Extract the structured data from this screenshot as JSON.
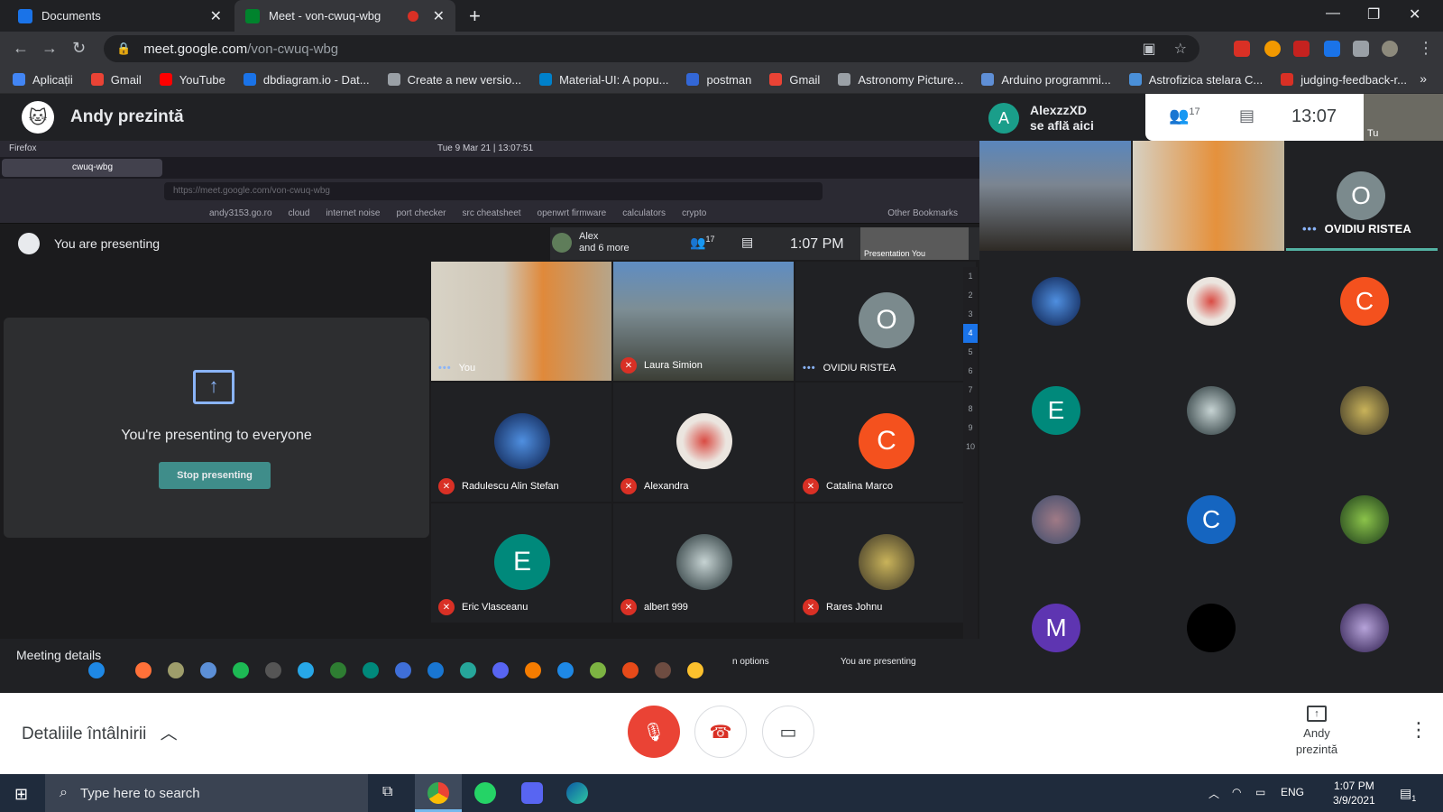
{
  "browser": {
    "tabs": [
      {
        "title": "Documents",
        "favicon_color": "#1a73e8"
      },
      {
        "title": "Meet - von-cwuq-wbg",
        "favicon_color": "#00832d",
        "recording": true
      }
    ],
    "url_host": "meet.google.com",
    "url_path": "/von-cwuq-wbg",
    "bookmarks": [
      {
        "label": "Aplicații",
        "icon_color": "#4285f4"
      },
      {
        "label": "Gmail",
        "icon_color": "#ea4335"
      },
      {
        "label": "YouTube",
        "icon_color": "#ff0000"
      },
      {
        "label": "dbdiagram.io - Dat...",
        "icon_color": "#1a73e8"
      },
      {
        "label": "Create a new versio...",
        "icon_color": "#9aa0a6"
      },
      {
        "label": "Material-UI: A popu...",
        "icon_color": "#0081cb"
      },
      {
        "label": "postman",
        "icon_color": "#3367d6"
      },
      {
        "label": "Gmail",
        "icon_color": "#ea4335"
      },
      {
        "label": "Astronomy Picture...",
        "icon_color": "#9aa0a6"
      },
      {
        "label": "Arduino programmi...",
        "icon_color": "#5f8fd6"
      },
      {
        "label": "Astrofizica stelara C...",
        "icon_color": "#4a90d9"
      },
      {
        "label": "judging-feedback-r...",
        "icon_color": "#d93025"
      }
    ],
    "bookmarks_more": "»"
  },
  "meet": {
    "presenter_header": "Andy prezintă",
    "joined": {
      "initial": "A",
      "name": "AlexzzXD",
      "status": "se află aici"
    },
    "people_count": "17",
    "time": "13:07",
    "self_label": "Tu",
    "right_tiles": [
      {
        "name": "OVIDIU RISTEA",
        "initial": "O"
      }
    ],
    "right_initials": {
      "c1": "C",
      "e": "E",
      "c2": "C",
      "m": "M"
    },
    "bottom": {
      "details": "Detaliile întâlnirii",
      "presenter_line1": "Andy",
      "presenter_line2": "prezintă"
    }
  },
  "shared_screen": {
    "ff_app": "Firefox",
    "ff_datetime": "Tue 9 Mar 21 | 13:07:51",
    "ff_tab": "cwuq-wbg",
    "ff_url": "https://meet.google.com/von-cwuq-wbg",
    "ff_bookmarks": [
      "andy3153.go.ro",
      "cloud",
      "internet noise",
      "port checker",
      "src cheatsheet",
      "openwrt firmware",
      "calculators",
      "crypto"
    ],
    "ff_other": "Other Bookmarks",
    "you_are_presenting": "You are presenting",
    "alex_line1": "Alex",
    "alex_line2": "and 6 more",
    "inner_people": "17",
    "inner_time": "1:07 PM",
    "inner_thumb_labels": "Presentation  You",
    "presenting_to_everyone": "You're presenting to everyone",
    "stop_presenting": "Stop presenting",
    "tiles": [
      {
        "name": "You"
      },
      {
        "name": "Laura Simion"
      },
      {
        "name": "OVIDIU RISTEA",
        "initial": "O"
      },
      {
        "name": "Radulescu Alin Stefan"
      },
      {
        "name": "Alexandra"
      },
      {
        "name": "Catalina Marco",
        "initial": "C"
      },
      {
        "name": "Eric Vlasceanu",
        "initial": "E"
      },
      {
        "name": "albert 999"
      },
      {
        "name": "Rares Johnu"
      }
    ],
    "side_numbers": [
      "1",
      "2",
      "3",
      "4",
      "5",
      "6",
      "7",
      "8",
      "9",
      "10"
    ],
    "meeting_details": "Meeting details",
    "bottom_you_are_presenting": "You are presenting",
    "bottom_options": "n options"
  },
  "taskbar": {
    "search_placeholder": "Type here to search",
    "lang": "ENG",
    "time": "1:07 PM",
    "date": "3/9/2021",
    "notifications": "1"
  }
}
